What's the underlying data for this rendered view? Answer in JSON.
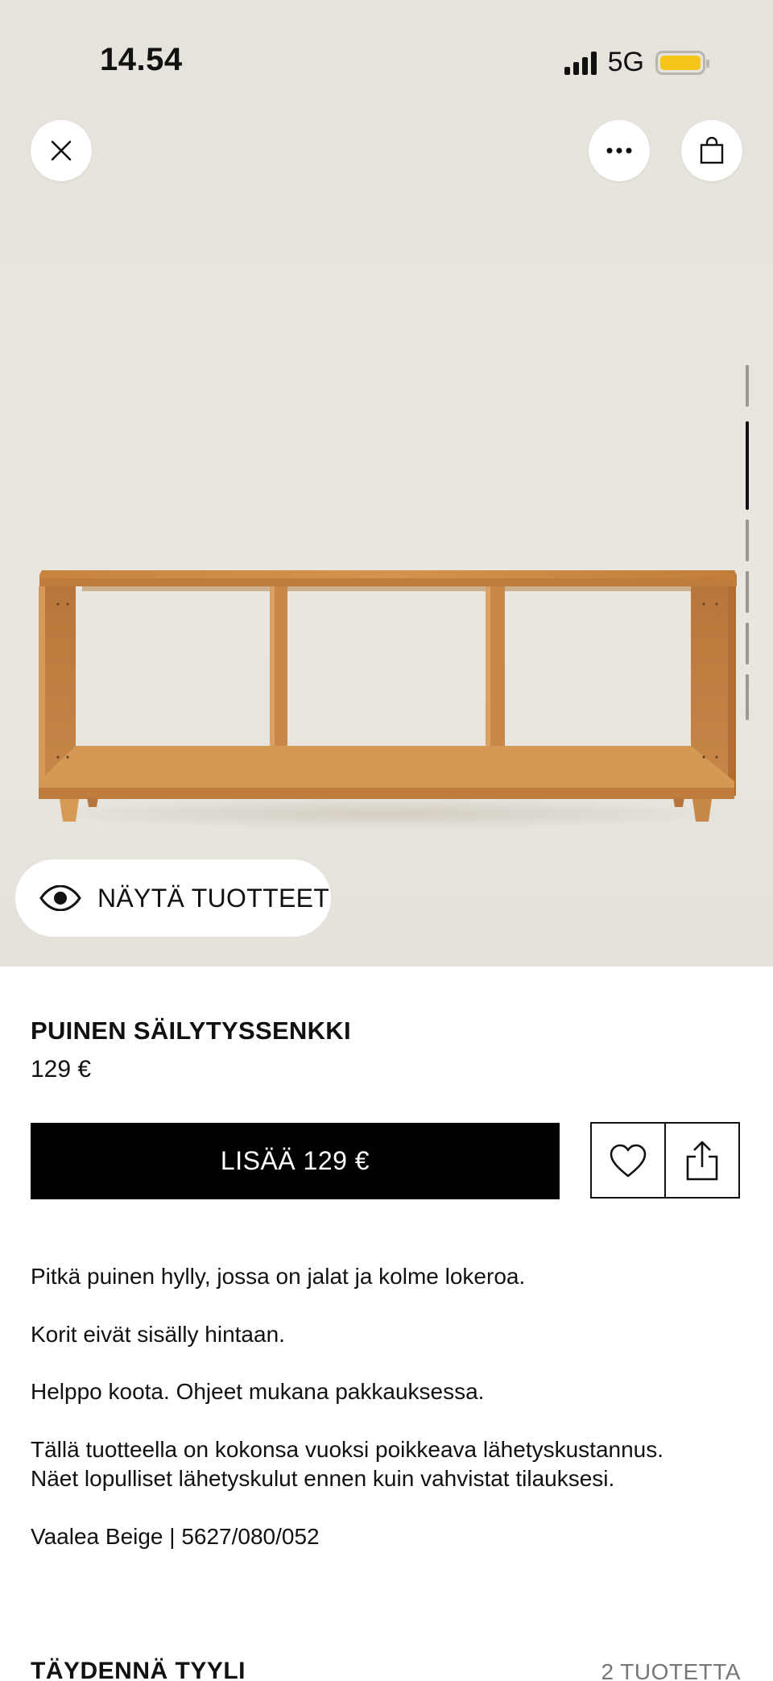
{
  "status_bar": {
    "time": "14.54",
    "network": "5G"
  },
  "colors": {
    "battery": "#f5c518",
    "wood": "#c98a45",
    "background": "#e8e5de"
  },
  "icons": {
    "close": "close-icon",
    "more": "more-icon",
    "bag": "bag-icon",
    "eye": "eye-icon",
    "heart": "heart-icon",
    "share": "share-icon"
  },
  "image_gallery": {
    "current_index": 2,
    "count": 6
  },
  "show_products": {
    "label": "NÄYTÄ TUOTTEET"
  },
  "product": {
    "title": "PUINEN SÄILYTYSSENKKI",
    "price": "129 €",
    "add_button": "LISÄÄ 129 €",
    "description": [
      "Pitkä puinen hylly, jossa on jalat ja kolme lokeroa.",
      "Korit eivät sisälly hintaan.",
      "Helppo koota. Ohjeet mukana pakkauksessa.",
      "Tällä tuotteella on kokonsa vuoksi poikkeava lähetyskustannus.",
      "Näet lopulliset lähetyskulut ennen kuin vahvistat tilauksesi.",
      "Vaalea Beige | 5627/080/052"
    ]
  },
  "complete_look": {
    "title": "TÄYDENNÄ TYYLI",
    "count": "2 TUOTETTA"
  }
}
